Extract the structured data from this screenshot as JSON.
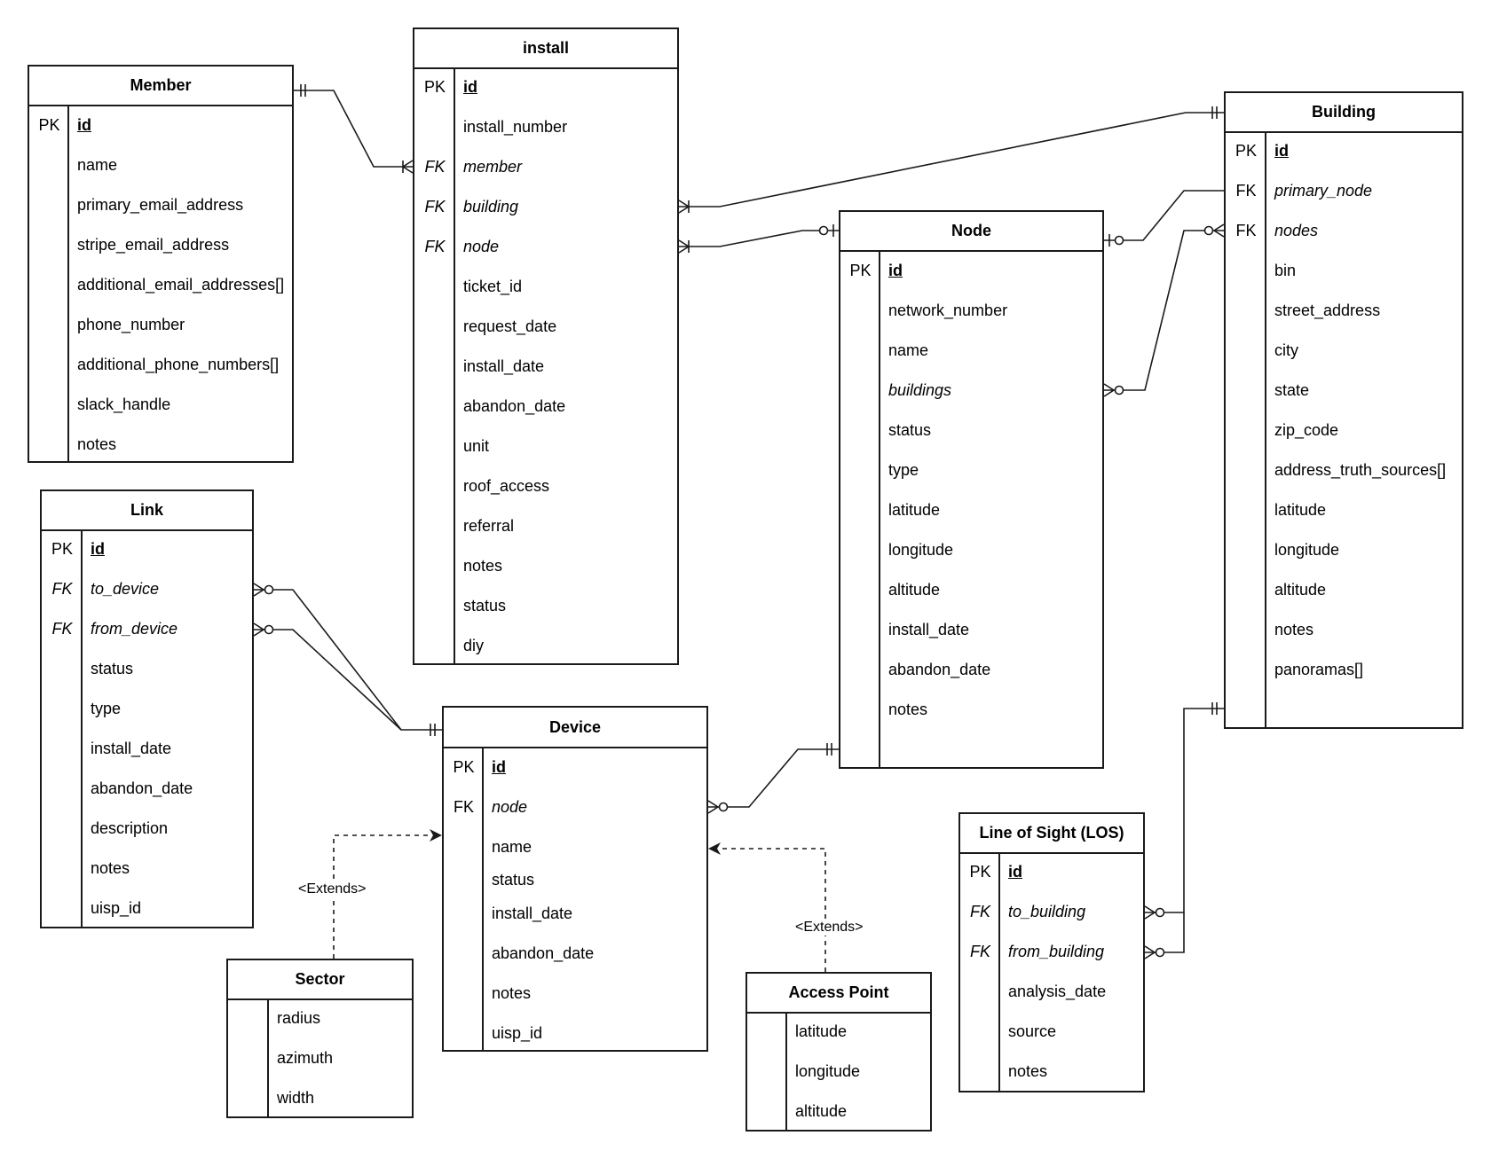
{
  "diagram": {
    "type": "entity-relationship",
    "entities": [
      {
        "id": "member",
        "title": "Member",
        "rows": [
          {
            "key": "PK",
            "field": "id",
            "style": "pk"
          },
          {
            "key": "",
            "field": "name"
          },
          {
            "key": "",
            "field": "primary_email_address"
          },
          {
            "key": "",
            "field": "stripe_email_address"
          },
          {
            "key": "",
            "field": "additional_email_addresses[]"
          },
          {
            "key": "",
            "field": "phone_number"
          },
          {
            "key": "",
            "field": "additional_phone_numbers[]"
          },
          {
            "key": "",
            "field": "slack_handle"
          },
          {
            "key": "",
            "field": "notes"
          }
        ]
      },
      {
        "id": "install",
        "title": "install",
        "rows": [
          {
            "key": "PK",
            "field": "id",
            "style": "pk"
          },
          {
            "key": "",
            "field": "install_number"
          },
          {
            "key": "FK",
            "field": "member",
            "style": "fk-italic"
          },
          {
            "key": "FK",
            "field": "building",
            "style": "fk-italic"
          },
          {
            "key": "FK",
            "field": "node",
            "style": "fk-italic"
          },
          {
            "key": "",
            "field": "ticket_id"
          },
          {
            "key": "",
            "field": "request_date"
          },
          {
            "key": "",
            "field": "install_date"
          },
          {
            "key": "",
            "field": "abandon_date"
          },
          {
            "key": "",
            "field": "unit"
          },
          {
            "key": "",
            "field": "roof_access"
          },
          {
            "key": "",
            "field": "referral"
          },
          {
            "key": "",
            "field": "notes"
          },
          {
            "key": "",
            "field": "status"
          },
          {
            "key": "",
            "field": "diy"
          }
        ]
      },
      {
        "id": "building",
        "title": "Building",
        "rows": [
          {
            "key": "PK",
            "field": "id",
            "style": "pk"
          },
          {
            "key": "FK",
            "field": "primary_node",
            "style": "fk"
          },
          {
            "key": "FK",
            "field": "nodes",
            "style": "fk"
          },
          {
            "key": "",
            "field": "bin"
          },
          {
            "key": "",
            "field": "street_address"
          },
          {
            "key": "",
            "field": "city"
          },
          {
            "key": "",
            "field": "state"
          },
          {
            "key": "",
            "field": "zip_code"
          },
          {
            "key": "",
            "field": "address_truth_sources[]"
          },
          {
            "key": "",
            "field": "latitude"
          },
          {
            "key": "",
            "field": "longitude"
          },
          {
            "key": "",
            "field": "altitude"
          },
          {
            "key": "",
            "field": "notes"
          },
          {
            "key": "",
            "field": "panoramas[]"
          }
        ]
      },
      {
        "id": "node",
        "title": "Node",
        "rows": [
          {
            "key": "PK",
            "field": "id",
            "style": "pk"
          },
          {
            "key": "",
            "field": "network_number"
          },
          {
            "key": "",
            "field": "name"
          },
          {
            "key": "",
            "field": "buildings",
            "style": "italic"
          },
          {
            "key": "",
            "field": "status"
          },
          {
            "key": "",
            "field": "type"
          },
          {
            "key": "",
            "field": "latitude"
          },
          {
            "key": "",
            "field": "longitude"
          },
          {
            "key": "",
            "field": "altitude"
          },
          {
            "key": "",
            "field": "install_date"
          },
          {
            "key": "",
            "field": "abandon_date"
          },
          {
            "key": "",
            "field": "notes"
          }
        ]
      },
      {
        "id": "link",
        "title": "Link",
        "rows": [
          {
            "key": "PK",
            "field": "id",
            "style": "pk"
          },
          {
            "key": "FK",
            "field": "to_device",
            "style": "fk-italic"
          },
          {
            "key": "FK",
            "field": "from_device",
            "style": "fk-italic"
          },
          {
            "key": "",
            "field": "status"
          },
          {
            "key": "",
            "field": "type"
          },
          {
            "key": "",
            "field": "install_date"
          },
          {
            "key": "",
            "field": "abandon_date"
          },
          {
            "key": "",
            "field": "description"
          },
          {
            "key": "",
            "field": "notes"
          },
          {
            "key": "",
            "field": "uisp_id"
          }
        ]
      },
      {
        "id": "device",
        "title": "Device",
        "rows": [
          {
            "key": "PK",
            "field": "id",
            "style": "pk"
          },
          {
            "key": "FK",
            "field": "node",
            "style": "fk"
          },
          {
            "key": "",
            "field": "name"
          },
          {
            "key": "",
            "field": "status"
          },
          {
            "key": "",
            "field": "install_date"
          },
          {
            "key": "",
            "field": "abandon_date"
          },
          {
            "key": "",
            "field": "notes"
          },
          {
            "key": "",
            "field": "uisp_id"
          }
        ]
      },
      {
        "id": "sector",
        "title": "Sector",
        "rows": [
          {
            "key": "",
            "field": "radius"
          },
          {
            "key": "",
            "field": "azimuth"
          },
          {
            "key": "",
            "field": "width"
          }
        ]
      },
      {
        "id": "access_point",
        "title": "Access Point",
        "rows": [
          {
            "key": "",
            "field": "latitude"
          },
          {
            "key": "",
            "field": "longitude"
          },
          {
            "key": "",
            "field": "altitude"
          }
        ]
      },
      {
        "id": "los",
        "title": "Line of Sight (LOS)",
        "rows": [
          {
            "key": "PK",
            "field": "id",
            "style": "pk"
          },
          {
            "key": "FK",
            "field": "to_building",
            "style": "fk-italic"
          },
          {
            "key": "FK",
            "field": "from_building",
            "style": "fk-italic"
          },
          {
            "key": "",
            "field": "analysis_date"
          },
          {
            "key": "",
            "field": "source"
          },
          {
            "key": "",
            "field": "notes"
          }
        ]
      }
    ],
    "relationships": [
      {
        "from": "member.id",
        "from_card": "exactly-one",
        "to": "install.member",
        "to_card": "one-or-many"
      },
      {
        "from": "install.building",
        "from_card": "one-or-many",
        "to": "building.id",
        "to_card": "exactly-one"
      },
      {
        "from": "install.node",
        "from_card": "one-or-many",
        "to": "node.id",
        "to_card": "zero-or-one"
      },
      {
        "from": "node.id",
        "from_card": "zero-or-one",
        "to": "building.primary_node",
        "to_card": "none"
      },
      {
        "from": "node.buildings",
        "from_card": "zero-or-many",
        "to": "building.nodes",
        "to_card": "zero-or-many"
      },
      {
        "from": "link.to_device",
        "from_card": "zero-or-many",
        "to": "device.id",
        "to_card": "exactly-one"
      },
      {
        "from": "link.from_device",
        "from_card": "zero-or-many",
        "to": "device.id",
        "to_card": "exactly-one"
      },
      {
        "from": "device.node",
        "from_card": "zero-or-many",
        "to": "node.id",
        "to_card": "exactly-one"
      },
      {
        "from": "los.to_building",
        "from_card": "zero-or-many",
        "to": "building.id",
        "to_card": "exactly-one"
      },
      {
        "from": "los.from_building",
        "from_card": "zero-or-many",
        "to": "building.id",
        "to_card": "exactly-one"
      }
    ],
    "inheritance": [
      {
        "child": "sector",
        "parent": "device",
        "label": "<Extends>"
      },
      {
        "child": "access_point",
        "parent": "device",
        "label": "<Extends>"
      }
    ]
  }
}
